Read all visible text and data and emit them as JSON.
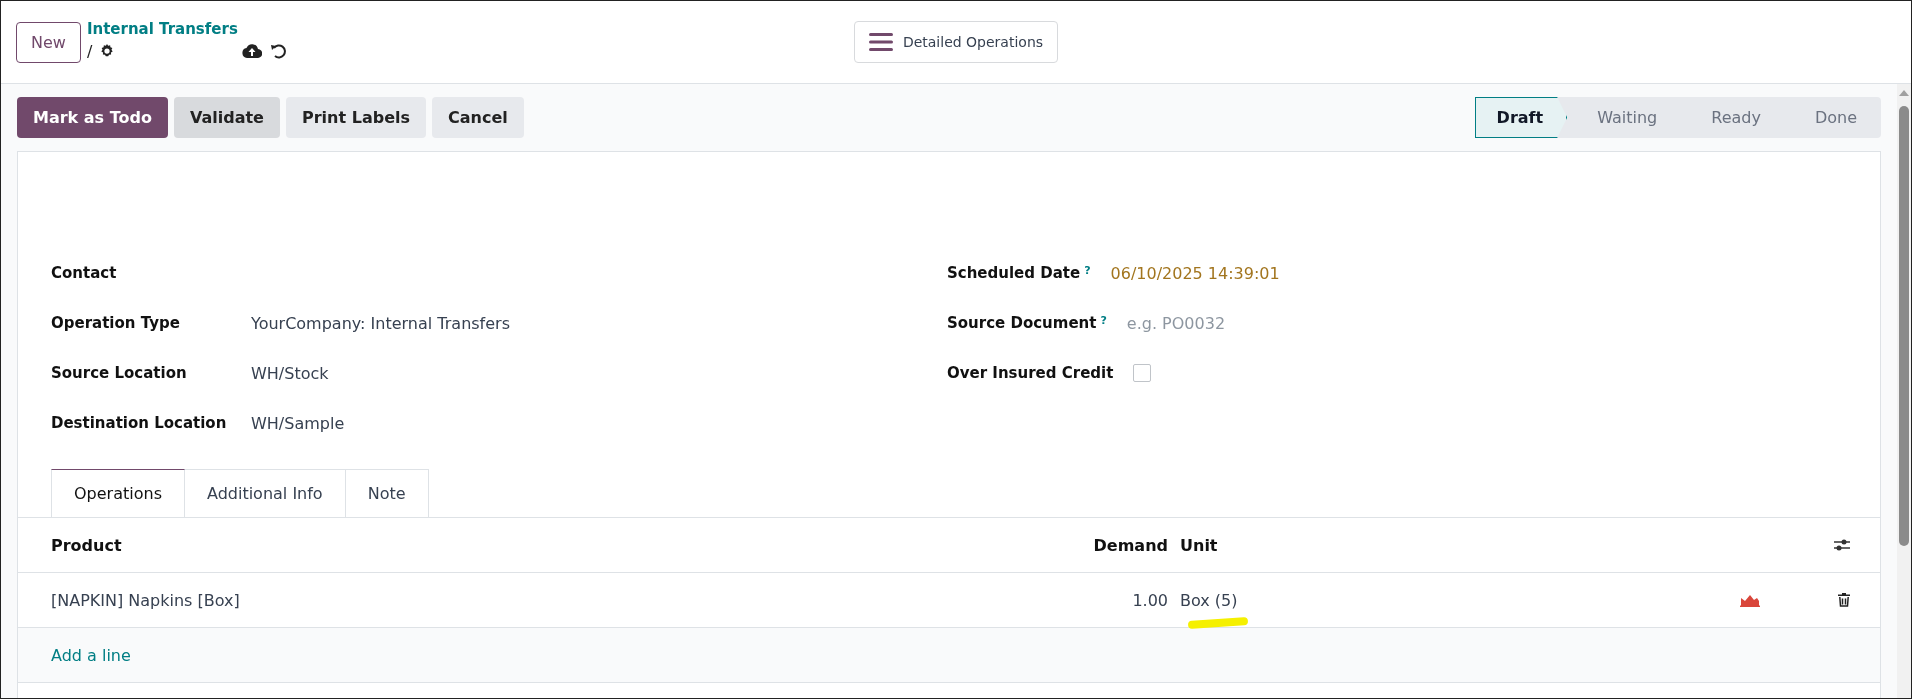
{
  "top_bar": {
    "new_button": "New",
    "breadcrumb": "Internal Transfers",
    "separator": "/",
    "view_button": "Detailed Operations"
  },
  "actions": [
    {
      "label": "Mark as Todo",
      "kind": "primary"
    },
    {
      "label": "Validate",
      "kind": "secondary"
    },
    {
      "label": "Print Labels",
      "kind": "light"
    },
    {
      "label": "Cancel",
      "kind": "light"
    }
  ],
  "stages": [
    {
      "label": "Draft",
      "selected": true
    },
    {
      "label": "Waiting",
      "selected": false
    },
    {
      "label": "Ready",
      "selected": false
    },
    {
      "label": "Done",
      "selected": false
    }
  ],
  "left_fields": [
    {
      "label": "Contact"
    },
    {
      "label": "Operation Type",
      "value": "YourCompany: Internal Transfers"
    },
    {
      "label": "Source Location",
      "value": "WH/Stock"
    },
    {
      "label": "Destination Location",
      "value": "WH/Sample"
    }
  ],
  "right_fields": [
    {
      "label": "Scheduled Date",
      "help": "?",
      "kind": "date",
      "value": "06/10/2025 14:39:01"
    },
    {
      "label": "Source Document",
      "help": "?",
      "kind": "text",
      "placeholder": "e.g. PO0032"
    },
    {
      "label": "Over Insured Credit",
      "kind": "checkbox",
      "checked": false
    }
  ],
  "tabs": [
    {
      "label": "Operations",
      "selected": true
    },
    {
      "label": "Additional Info",
      "selected": false
    },
    {
      "label": "Note",
      "selected": false
    }
  ],
  "table": {
    "columns": [
      "Product",
      "Demand",
      "Unit"
    ],
    "rows": [
      {
        "product": "[NAPKIN] Napkins [Box]",
        "demand": "1.00",
        "unit": "Box (5)",
        "highlighted": true
      }
    ],
    "add_line": "Add a line"
  }
}
